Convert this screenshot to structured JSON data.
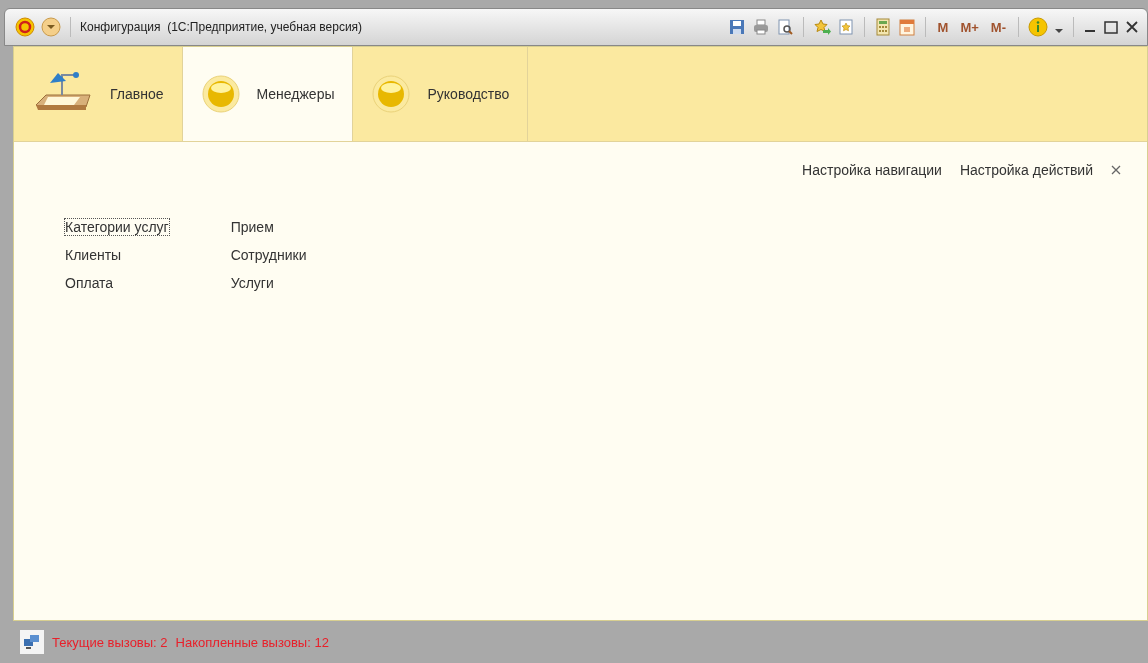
{
  "window": {
    "title": "Конфигурация  (1С:Предприятие, учебная версия)",
    "memory_buttons": [
      "M",
      "M+",
      "M-"
    ]
  },
  "sections": [
    {
      "label": "Главное",
      "kind": "home",
      "selected": false
    },
    {
      "label": "Менеджеры",
      "kind": "orb",
      "selected": true
    },
    {
      "label": "Руководство",
      "kind": "orb",
      "selected": false
    }
  ],
  "actions": [
    "Настройка навигации",
    "Настройка действий"
  ],
  "columns": [
    [
      {
        "label": "Категории услуг",
        "focused": true
      },
      {
        "label": "Клиенты",
        "focused": false
      },
      {
        "label": "Оплата",
        "focused": false
      }
    ],
    [
      {
        "label": "Прием",
        "focused": false
      },
      {
        "label": "Сотрудники",
        "focused": false
      },
      {
        "label": "Услуги",
        "focused": false
      }
    ]
  ],
  "status_bar": {
    "items": [
      "Текущие вызовы: 2",
      "Накопленные вызовы: 12"
    ]
  }
}
